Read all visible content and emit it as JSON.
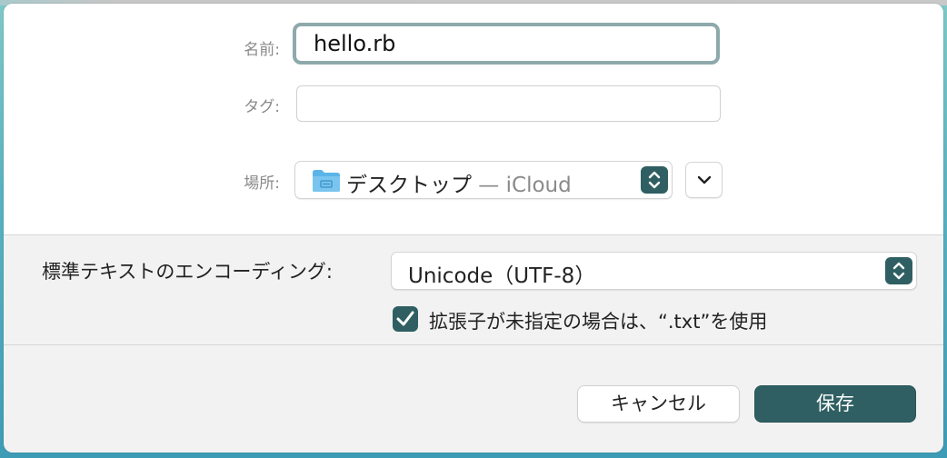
{
  "dialog": {
    "name_label": "名前:",
    "name_value": "hello.rb",
    "tags_label": "タグ:",
    "tags_value": "",
    "where_label": "場所:",
    "where_folder": "デスクトップ",
    "where_location": " — iCloud",
    "encoding_label": "標準テキストのエンコーディング:",
    "encoding_value": "Unicode（UTF-8）",
    "checkbox_checked": true,
    "checkbox_label": "拡張子が未指定の場合は、“.txt”を使用",
    "cancel_label": "キャンセル",
    "save_label": "保存"
  },
  "icons": {
    "folder": "folder-icon",
    "stepper": "up-down-chevron-icon",
    "expand": "chevron-down-icon",
    "check": "checkmark-icon"
  },
  "colors": {
    "accent": "#2f5f62",
    "focus_ring": "#8ea9ab",
    "folder_blue": "#5ab4e8"
  }
}
